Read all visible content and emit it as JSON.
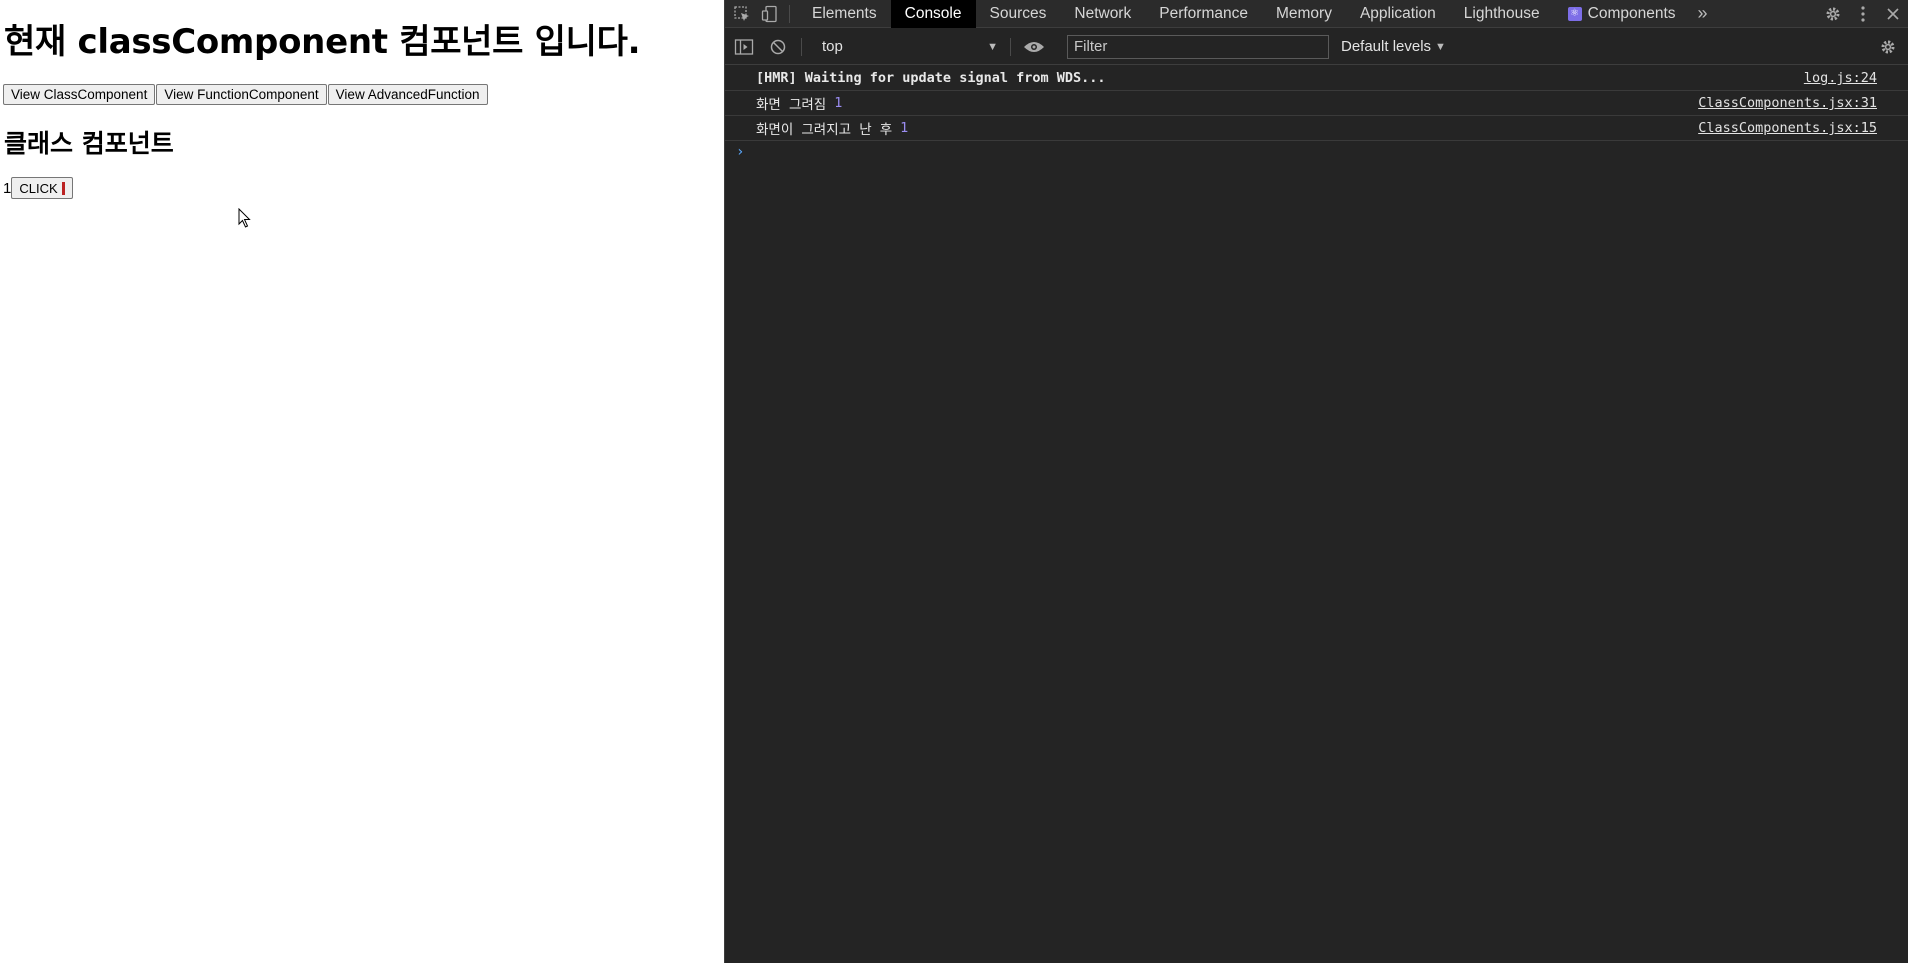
{
  "app": {
    "heading": "현재 classComponent 컴포넌트 입니다.",
    "nav_buttons": [
      "View ClassComponent",
      "View FunctionComponent",
      "View AdvancedFunction"
    ],
    "subheading": "클래스 컴포넌트",
    "count": "1",
    "click_label": "CLICK"
  },
  "devtools": {
    "tabs": [
      "Elements",
      "Console",
      "Sources",
      "Network",
      "Performance",
      "Memory",
      "Application",
      "Lighthouse",
      "Components"
    ],
    "active_tab": "Console",
    "context": "top",
    "filter_placeholder": "Filter",
    "levels": "Default levels",
    "messages": [
      {
        "text": "[HMR] Waiting for update signal from WDS...",
        "num": "",
        "source": "log.js:24"
      },
      {
        "text": "화면 그려짐",
        "num": "1",
        "source": "ClassComponents.jsx:31"
      },
      {
        "text": "화면이 그려지고 난 후",
        "num": "1",
        "source": "ClassComponents.jsx:15"
      }
    ],
    "prompt_symbol": "›"
  },
  "colors": {
    "devtools_bg": "#242424",
    "active_tab_bg": "#000000",
    "number_color": "#9a8cf0",
    "prompt_color": "#5aa9ff",
    "components_icon": "#7d6ee7"
  }
}
